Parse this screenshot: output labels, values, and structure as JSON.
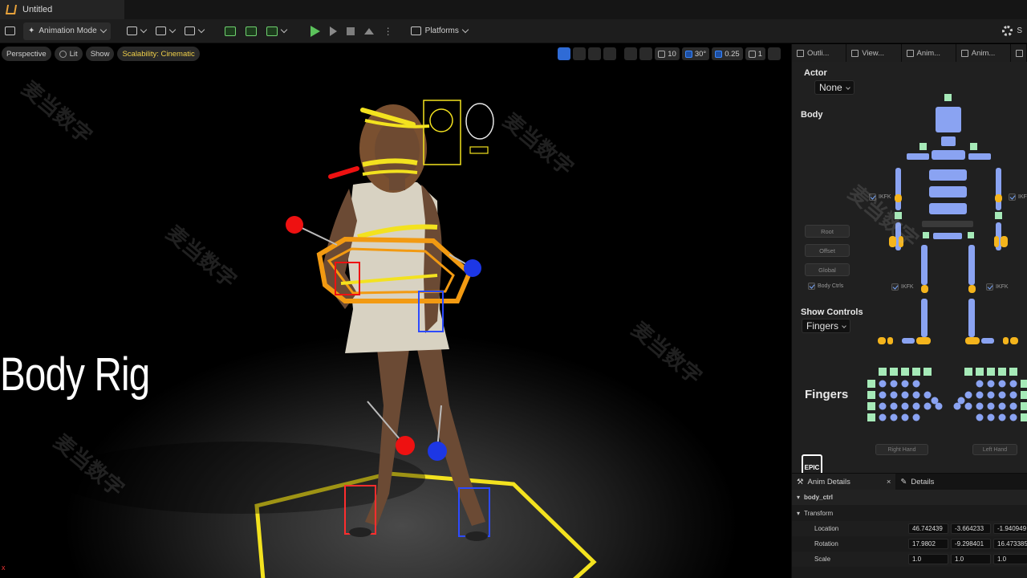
{
  "window": {
    "doc_tab": "Untitled"
  },
  "toolbar": {
    "mode": "Animation Mode",
    "platforms": "Platforms",
    "settings_label": "S"
  },
  "viewport": {
    "perspective": "Perspective",
    "lit": "Lit",
    "show": "Show",
    "scalability": "Scalability: Cinematic",
    "grid_snap": "10",
    "rot_snap": "30°",
    "scale_snap": "0.25",
    "camera_speed": "1",
    "overlay_title": "Body Rig",
    "corner_mark": "x",
    "watermark": "麦当数字"
  },
  "panel": {
    "tabs": [
      "Outli...",
      "View...",
      "Anim...",
      "Anim..."
    ],
    "actor_label": "Actor",
    "actor_value": "None",
    "body_label": "Body",
    "buttons": [
      "Root",
      "Offset",
      "Global"
    ],
    "body_ctrls": "Body Ctrls",
    "ikfk": "IKFK",
    "show_controls_label": "Show Controls",
    "show_controls_value": "Fingers",
    "fingers_label": "Fingers",
    "right_hand": "Right Hand",
    "left_hand": "Left Hand",
    "logo": "EPIC"
  },
  "details": {
    "tab_anim": "Anim Details",
    "tab_close": "×",
    "tab_details": "Details",
    "object": "body_ctrl",
    "section": "Transform",
    "rows": [
      {
        "label": "Location",
        "x": "46.742439",
        "y": "-3.664233",
        "z": "-1.940949"
      },
      {
        "label": "Rotation",
        "x": "17.9802",
        "y": "-9.298401",
        "z": "16.473385"
      },
      {
        "label": "Scale",
        "x": "1.0",
        "y": "1.0",
        "z": "1.0"
      }
    ]
  },
  "colors": {
    "accent_blue": "#2f6bd6",
    "rig_yellow": "#f3e21f",
    "rig_orange": "#f29a12",
    "picker_blue": "#8aa3f2",
    "picker_green": "#a6eab8",
    "picker_orange": "#f4b41c"
  }
}
